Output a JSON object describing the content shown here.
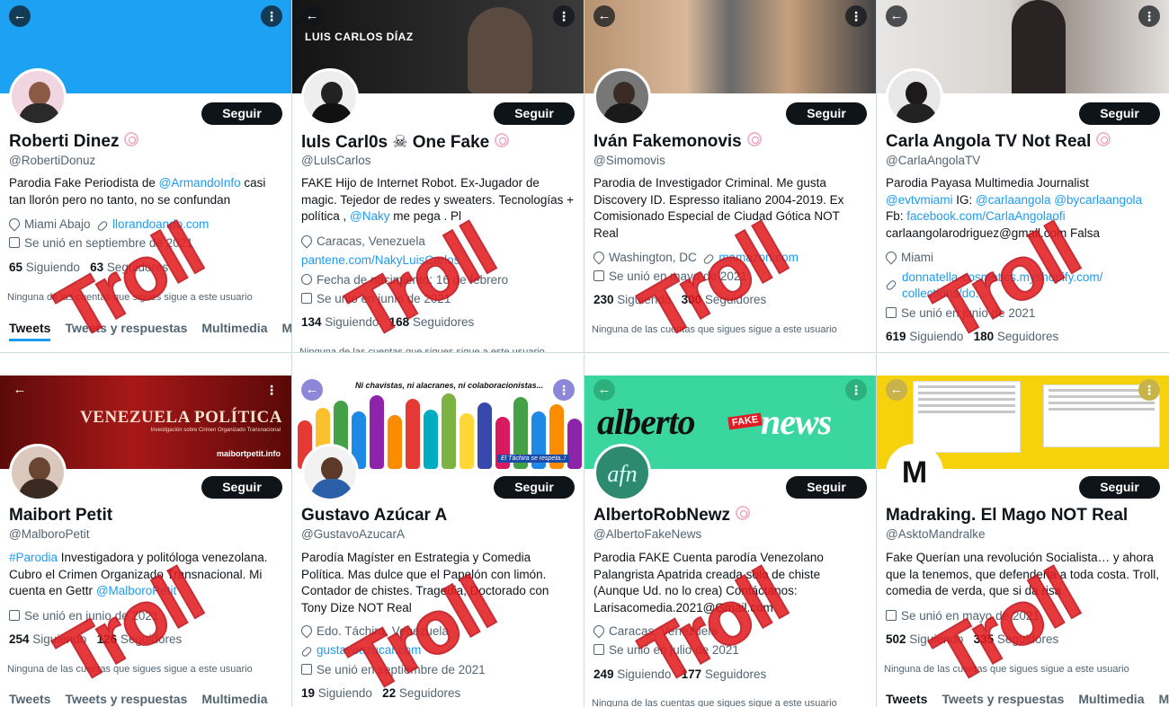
{
  "ui": {
    "follow_label": "Seguir",
    "back_glyph": "←",
    "more_glyph": "⋮",
    "troll_stamp": "Troll",
    "tab_tweets": "Tweets",
    "tab_replies": "Tweets y respuestas",
    "tab_media": "Multimedia",
    "tab_cut": "M",
    "mutual_text": "Ninguna de las cuentas que sigues sigue a este usuario",
    "following_label": "Siguiendo",
    "followers_label": "Seguidores"
  },
  "profiles": [
    {
      "name": "Roberti Dinez",
      "handle": "@RobertiDonuz",
      "bio_pre": "Parodia Fake Periodista de ",
      "bio_link": "@ArmandoInfo",
      "bio_post": " casi tan llorón pero no tanto, no se confundan",
      "location": "Miami Abajo",
      "website": "llorandoando.com",
      "joined": "Se unió en septiembre de 2021",
      "following": "65",
      "followers": "63"
    },
    {
      "name": "luls Carl0s ☠ One Fake",
      "handle": "@LulsCarlos",
      "bio_pre": "FAKE Hijo de Internet Robot. Ex-Jugador de magic. Tejedor de redes y sweaters. Tecnologías + política , ",
      "bio_link": "@Naky",
      "bio_post": " me pega . Pl",
      "location": "Caracas, Venezuela",
      "website": "pantene.com/NakyLuisCarlos",
      "birthday": "Fecha de nacimiento: 16 de febrero",
      "joined": "Se unió en junio de 2021",
      "following": "134",
      "followers": "168",
      "banner_title": "LUIS CARLOS DÍAZ"
    },
    {
      "name": "Iván Fakemonovis",
      "handle": "@Simomovis",
      "bio_pre": "Parodia de Investigador Criminal. Me gusta Discovery ID. Espresso italiano 2004-2019.  Ex Comisionado Especial de Ciudad Gótica NOT Real",
      "bio_link": "",
      "bio_post": "",
      "location": "Washington, DC",
      "website": "mamazon.com",
      "joined": "Se unió en mayo de 2021",
      "following": "230",
      "followers": "300"
    },
    {
      "name": "Carla Angola TV Not Real",
      "handle": "@CarlaAngolaTV",
      "bio_line1": "Parodia Payasa Multimedia Journalist",
      "bio_l2a": "@evtvmiami",
      "bio_l2b": " IG: ",
      "bio_l2c": "@carlaangola @bycarlaangola",
      "bio_l3a": "Fb: ",
      "bio_l3b": "facebook.com/CarlaAngolaofi",
      "bio_line4": "carlaangolarodriguez@gmail.com Falsa",
      "location": "Miami",
      "website": "donnatella-cosmetics.myshopify.com/ collections/do...",
      "joined": "Se unió en junio de 2021",
      "following": "619",
      "followers": "180"
    },
    {
      "name": "Maibort Petit",
      "handle": "@MalboroPetit",
      "bio_tag": "#Parodia",
      "bio_pre": " Investigadora y politóloga venezolana. Cubro el Crimen Organizado Transnacional. Mi cuenta en Gettr ",
      "bio_link": "@MalboroPetit",
      "joined": "Se unió en junio de 2021",
      "following": "254",
      "followers": "126",
      "banner_title": "VENEZUELA POLÍTICA",
      "banner_sub": "Investigación sobre Crimen Organizado Transnacional",
      "banner_site": "maibortpetit.info"
    },
    {
      "name": "Gustavo Azúcar A",
      "handle": "@GustavoAzucarA",
      "bio_pre": "Parodía Magíster en Estrategia y Comedia Política. Mas dulce que el Papelón con limón. Contador de chistes. Tragedia, Doctorado con Tony Dize NOT Real",
      "bio_link": "",
      "bio_post": "",
      "location": "Edo. Táchira, Venezuela",
      "website": "gustavoazucar.com",
      "joined": "Se unió en septiembre de 2021",
      "following": "19",
      "followers": "22",
      "banner_title": "Ni chavistas, ni alacranes, ni colaboracionistas...",
      "banner_sub": "El Táchira se respeta..!"
    },
    {
      "name": "AlbertoRobNewz",
      "handle": "@AlbertoFakeNews",
      "bio_pre": "Parodia FAKE Cuenta parodía Venezolano Palangrista Apatrida  creada solo de chiste (Aunque Ud. no lo crea)  Contáctanos: Larisacomedia.2021@Gmail.com",
      "bio_link": "",
      "bio_post": "",
      "location": "Caracas, Venezuela",
      "joined": "Se unió en julio de 2021",
      "following": "249",
      "followers": "177",
      "banner_alberto": "alberto",
      "banner_fake": "FAKE",
      "banner_news": "news",
      "avatar_text": "afn"
    },
    {
      "name": "Madraking. El Mago NOT Real",
      "handle": "@AsktoMandralke",
      "bio_pre": "Fake Querían una revolución Socialista… y ahora que la tenemos, que defenderla a toda costa. Troll, comedia de verda, que si da risa",
      "bio_link": "",
      "bio_post": "",
      "joined": "Se unió en mayo de 2021",
      "following": "502",
      "followers": "335",
      "avatar_text": "M"
    }
  ],
  "colors": {
    "twitter_blue": "#1d9bf0",
    "troll_red": "#e31e22",
    "banner_blue": "#1da1f2",
    "alberto_green": "#3ad6a0",
    "madraking_yellow": "#f5d20b"
  }
}
